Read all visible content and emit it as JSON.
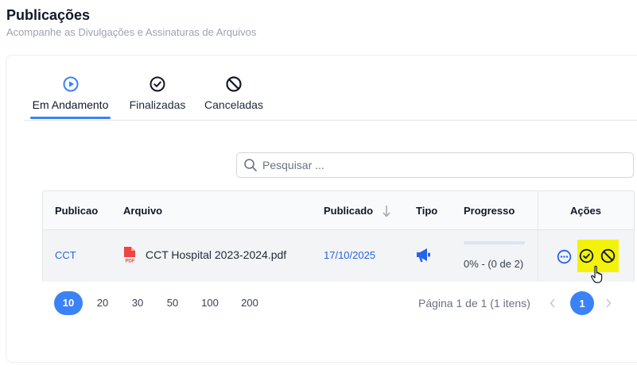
{
  "header": {
    "title": "Publicações",
    "subtitle": "Acompanhe as Divulgações e Assinaturas de Arquivos"
  },
  "tabs": [
    {
      "label": "Em Andamento",
      "icon": "play-circle-icon",
      "active": true
    },
    {
      "label": "Finalizadas",
      "icon": "check-circle-icon",
      "active": false
    },
    {
      "label": "Canceladas",
      "icon": "ban-icon",
      "active": false
    }
  ],
  "search": {
    "placeholder": "Pesquisar ..."
  },
  "table": {
    "columns": {
      "publicacao": "Publicao",
      "arquivo": "Arquivo",
      "publicado": "Publicado",
      "tipo": "Tipo",
      "progresso": "Progresso",
      "acoes": "Ações"
    },
    "sort": {
      "column": "publicado",
      "direction": "desc"
    },
    "rows": [
      {
        "publicacao": "CCT",
        "arquivo": "CCT Hospital 2023-2024.pdf",
        "publicado": "17/10/2025",
        "tipo_icon": "megaphone-icon",
        "progress_fraction": 0.0,
        "progresso_text": "0% - (0 de 2)"
      }
    ]
  },
  "pagination": {
    "page_sizes": [
      "10",
      "20",
      "30",
      "50",
      "100",
      "200"
    ],
    "selected_size": "10",
    "info": "Página 1 de 1 (1 itens)",
    "current_page": "1"
  },
  "colors": {
    "accent": "#3b82f6",
    "link": "#2563eb",
    "pdf_icon": "#ef4444",
    "highlight": "#f3f30a",
    "action_icon": "#111827"
  }
}
